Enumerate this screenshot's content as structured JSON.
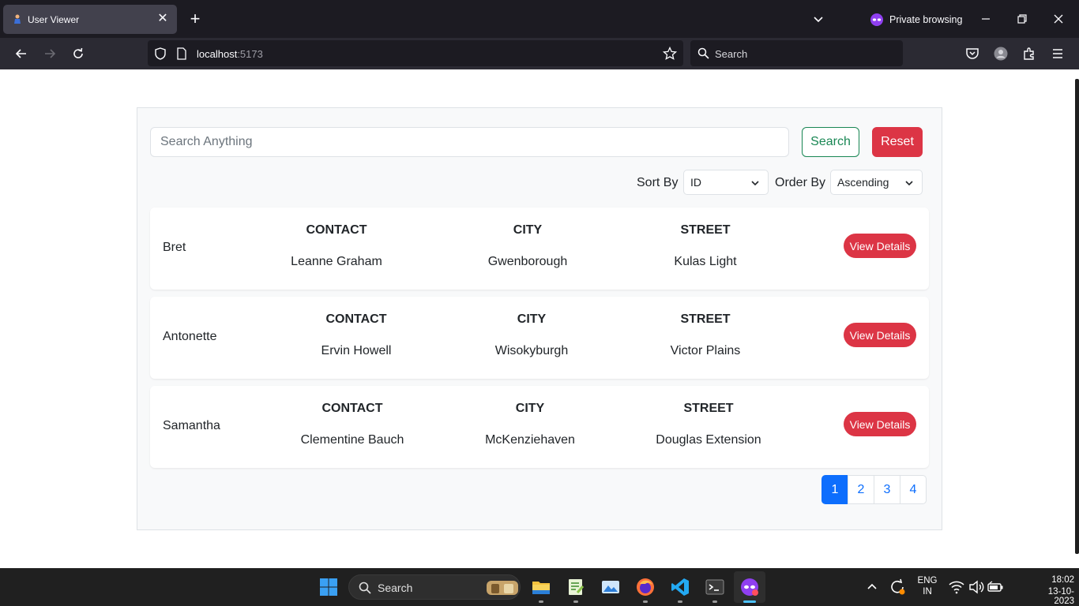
{
  "browser": {
    "tab_title": "User Viewer",
    "private_label": "Private browsing",
    "url_host": "localhost",
    "url_port": ":5173",
    "search_placeholder": "Search"
  },
  "app": {
    "search_placeholder": "Search Anything",
    "search_button": "Search",
    "reset_button": "Reset",
    "sort_by_label": "Sort By",
    "sort_by_value": "ID",
    "order_by_label": "Order By",
    "order_by_value": "Ascending",
    "users": [
      {
        "username": "Bret",
        "contact_header": "CONTACT",
        "contact": "Leanne Graham",
        "city_header": "CITY",
        "city": "Gwenborough",
        "street_header": "STREET",
        "street": "Kulas Light",
        "button": "View Details"
      },
      {
        "username": "Antonette",
        "contact_header": "CONTACT",
        "contact": "Ervin Howell",
        "city_header": "CITY",
        "city": "Wisokyburgh",
        "street_header": "STREET",
        "street": "Victor Plains",
        "button": "View Details"
      },
      {
        "username": "Samantha",
        "contact_header": "CONTACT",
        "contact": "Clementine Bauch",
        "city_header": "CITY",
        "city": "McKenziehaven",
        "street_header": "STREET",
        "street": "Douglas Extension",
        "button": "View Details"
      }
    ],
    "pages": [
      "1",
      "2",
      "3",
      "4"
    ],
    "active_page": "1"
  },
  "taskbar": {
    "search_placeholder": "Search",
    "language": "ENG",
    "region": "IN",
    "time": "18:02",
    "date": "13-10-2023"
  },
  "colors": {
    "danger": "#dc3545",
    "success": "#198754",
    "primary": "#0d6efd"
  }
}
